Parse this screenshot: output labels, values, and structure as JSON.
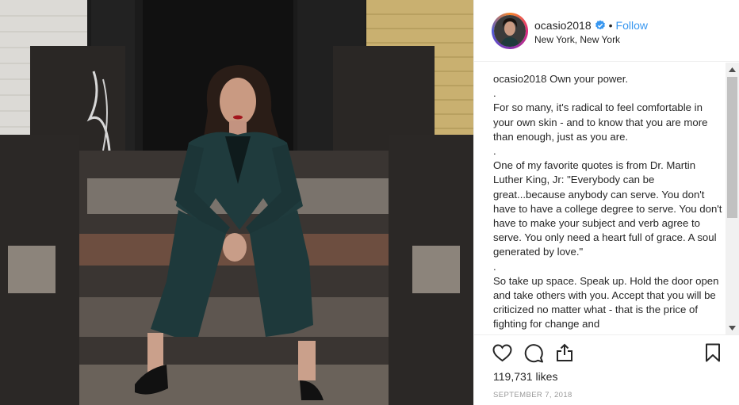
{
  "post": {
    "username": "ocasio2018",
    "separator": "•",
    "follow_label": "Follow",
    "location": "New York, New York",
    "caption_user": "ocasio2018",
    "caption_lines": [
      "Own your power.",
      ".",
      "For so many, it's radical to feel comfortable in your own skin - and to know that you are more than enough, just as you are.",
      ".",
      "One of my favorite quotes is from Dr. Martin Luther King, Jr: \"Everybody can be great...because anybody can serve. You don't have to have a college degree to serve. You don't have to make your subject and verb agree to serve. You only need a heart full of grace. A soul generated by love.\"",
      ".",
      "So take up space. Speak up. Hold the door open and take others with you. Accept that you will be criticized no matter what - that is the price of fighting for change and"
    ],
    "likes": "119,731 likes",
    "date": "SEPTEMBER 7, 2018"
  },
  "colors": {
    "accent": "#3897f0",
    "text": "#262626",
    "muted": "#999999",
    "border": "#efefef"
  },
  "icons": [
    "verified-badge-icon",
    "heart-icon",
    "comment-icon",
    "share-icon",
    "bookmark-icon"
  ]
}
